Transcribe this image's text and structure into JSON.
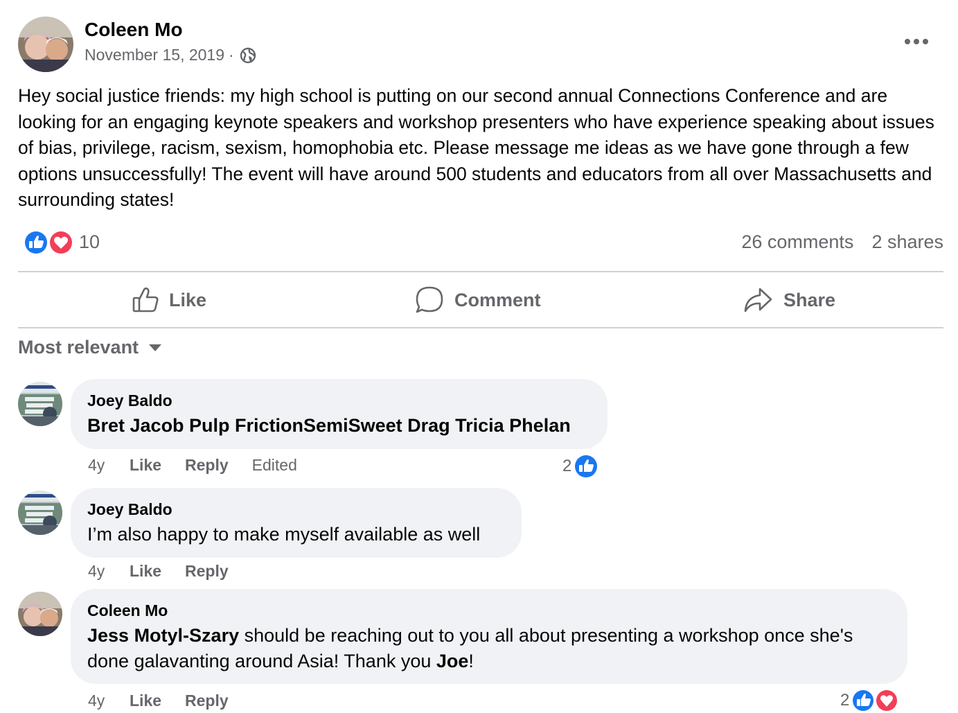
{
  "post": {
    "author": "Coleen Mo",
    "date": "November 15, 2019",
    "separator": "·",
    "audience_icon": "globe-icon",
    "more_icon": "more-options-icon",
    "text": "Hey social justice friends: my high school is putting on our second annual Connections Conference and are looking for an engaging keynote speakers and workshop presenters who have experience speaking about issues of bias, privilege, racism, sexism, homophobia etc. Please message me ideas as we have gone through a few options unsuccessfully! The event will have around 500 students and educators from all over Massachusetts and surrounding states!"
  },
  "reactions": {
    "types": [
      "like",
      "love"
    ],
    "count": "10",
    "comments": "26 comments",
    "shares": "2 shares"
  },
  "actions": {
    "like": "Like",
    "comment": "Comment",
    "share": "Share"
  },
  "sort": {
    "label": "Most relevant"
  },
  "colors": {
    "like_blue": "#1877f2",
    "love_red": "#f33e58",
    "secondary_text": "#65676b",
    "bubble_bg": "#f0f2f5"
  },
  "comments": [
    {
      "author": "Joey Baldo",
      "text": "Bret Jacob Pulp FrictionSemiSweet Drag Tricia Phelan",
      "time": "4y",
      "like": "Like",
      "reply": "Reply",
      "edited": "Edited",
      "reaction_count": "2"
    },
    {
      "author": "Joey Baldo",
      "text": "I’m also happy to make myself available as well",
      "time": "4y",
      "like": "Like",
      "reply": "Reply"
    },
    {
      "author": "Coleen Mo",
      "mention_1": "Jess Motyl-Szary",
      "text_1": " should be reaching out to you all about presenting a workshop once she's done galavanting around Asia! Thank you ",
      "mention_2": "Joe",
      "text_2": "!",
      "time": "4y",
      "like": "Like",
      "reply": "Reply",
      "reaction_count": "2"
    }
  ]
}
